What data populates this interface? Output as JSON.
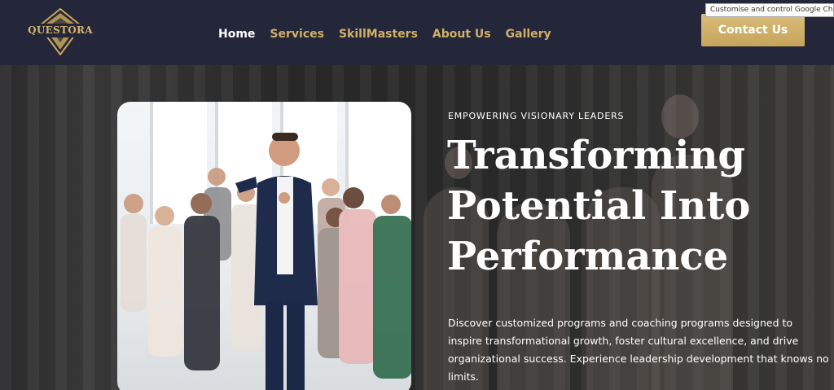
{
  "logo": {
    "text": "QUESTORA"
  },
  "nav": {
    "items": [
      {
        "label": "Home",
        "active": true
      },
      {
        "label": "Services"
      },
      {
        "label": "SkillMasters"
      },
      {
        "label": "About Us"
      },
      {
        "label": "Gallery"
      }
    ]
  },
  "contact": {
    "label": "Contact Us"
  },
  "tooltip": {
    "text": "Customise and control Google Chrome"
  },
  "hero": {
    "eyebrow": "EMPOWERING VISIONARY LEADERS",
    "title_lines": [
      "Transforming",
      "Potential Into",
      "Performance"
    ],
    "description_lines": [
      "Discover customized programs and coaching programs designed to",
      "inspire transformational growth, foster cultural excellence, and drive",
      "organizational success. Experience leadership development that knows no",
      "limits."
    ]
  },
  "colors": {
    "header_bg": "#242639",
    "accent_gold": "#d1b067",
    "button_gold": "#c7a45b"
  }
}
